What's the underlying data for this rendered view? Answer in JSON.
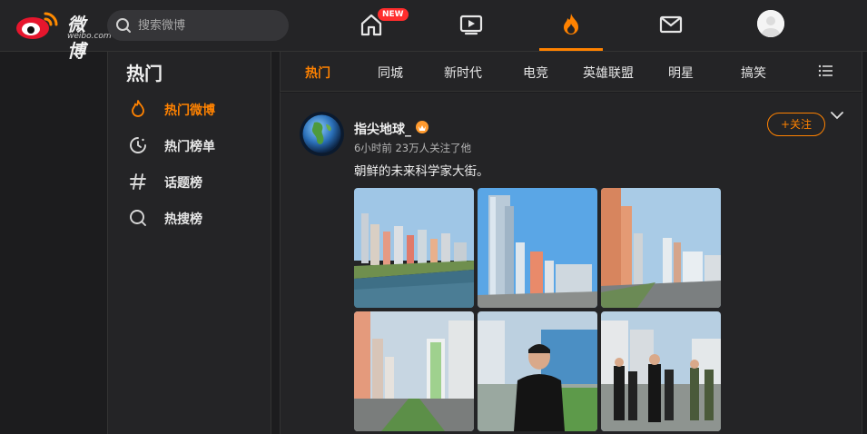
{
  "brand": {
    "name": "微博",
    "sub": "weibo.com"
  },
  "search": {
    "placeholder": "搜索微博"
  },
  "topnav": {
    "new_badge": "NEW"
  },
  "sidebar": {
    "title": "热门",
    "items": [
      {
        "label": "热门微博",
        "icon": "flame-icon"
      },
      {
        "label": "热门榜单",
        "icon": "clock-icon"
      },
      {
        "label": "话题榜",
        "icon": "hash-icon"
      },
      {
        "label": "热搜榜",
        "icon": "search-icon"
      }
    ]
  },
  "tabs": [
    "热门",
    "同城",
    "新时代",
    "电竞",
    "英雄联盟",
    "明星",
    "搞笑"
  ],
  "post": {
    "author": "指尖地球_",
    "meta": "6小时前  23万人关注了他",
    "text": "朝鲜的未来科学家大街。",
    "follow_label": "+关注"
  },
  "colors": {
    "accent": "#ff8200",
    "bg": "#1c1c1e",
    "panel": "#242426"
  }
}
